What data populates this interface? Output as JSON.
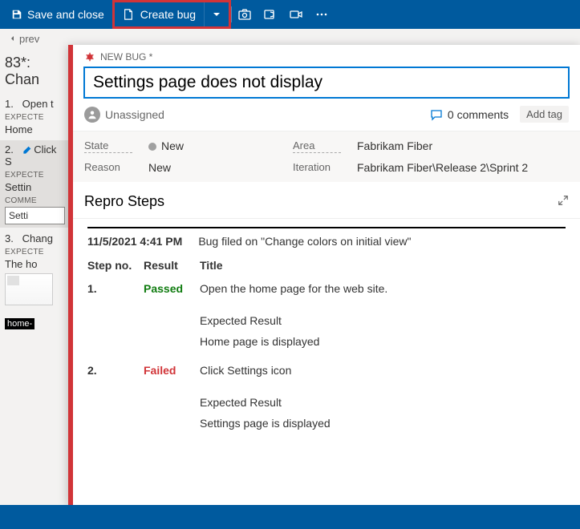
{
  "toolbar": {
    "save_label": "Save and close",
    "create_bug_label": "Create bug"
  },
  "breadcrumb": {
    "prev": "prev"
  },
  "left": {
    "title": "83*: Chan",
    "step1_num": "1.",
    "step1_text": "Open t",
    "expecte_label": "EXPECTE",
    "step1_exp": "Home",
    "step2_num": "2.",
    "step2_text": "Click S",
    "step2_exp": "Settin",
    "comme_label": "COMME",
    "step2_comment": "Setti",
    "step3_num": "3.",
    "step3_text": "Chang",
    "step3_exp": "The ho",
    "thumb_label": "home-"
  },
  "bug": {
    "type_label": "NEW BUG *",
    "title_value": "Settings page does not display",
    "assignee": "Unassigned",
    "comments_count": "0 comments",
    "add_tag": "Add tag",
    "fields": {
      "state_label": "State",
      "state_val": "New",
      "area_label": "Area",
      "area_val": "Fabrikam Fiber",
      "reason_label": "Reason",
      "reason_val": "New",
      "iteration_label": "Iteration",
      "iteration_val": "Fabrikam Fiber\\Release 2\\Sprint 2"
    }
  },
  "repro": {
    "section_title": "Repro Steps",
    "timestamp": "11/5/2021 4:41 PM",
    "filed_on": "Bug filed on \"Change colors on initial view\"",
    "headers": {
      "step": "Step no.",
      "result": "Result",
      "title": "Title"
    },
    "steps": [
      {
        "num": "1.",
        "result": "Passed",
        "title": "Open the home page for the web site.",
        "expected_label": "Expected Result",
        "expected": "Home page is displayed"
      },
      {
        "num": "2.",
        "result": "Failed",
        "title": "Click Settings icon",
        "expected_label": "Expected Result",
        "expected": "Settings page is displayed"
      }
    ]
  }
}
